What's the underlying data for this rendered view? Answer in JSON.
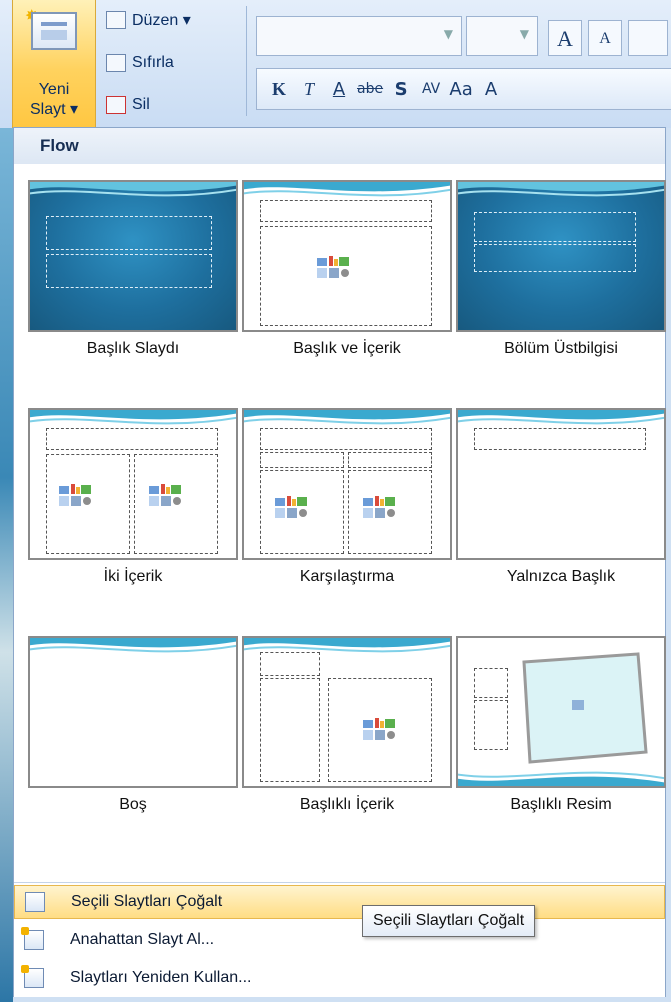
{
  "ribbon": {
    "new_slide_line1": "Yeni",
    "new_slide_line2": "Slayt ▾",
    "layout_label": "Düzen ▾",
    "reset_label": "Sıfırla",
    "delete_label": "Sil",
    "format_buttons": [
      "K",
      "T",
      "A",
      "abe",
      "S",
      "AV",
      "Aa",
      "A"
    ],
    "grow_font": "A",
    "shrink_font": "A"
  },
  "panel": {
    "theme_header": "Flow",
    "layouts": [
      {
        "caption": "Başlık Slaydı"
      },
      {
        "caption": "Başlık ve İçerik"
      },
      {
        "caption": "Bölüm Üstbilgisi"
      },
      {
        "caption": "İki İçerik"
      },
      {
        "caption": "Karşılaştırma"
      },
      {
        "caption": "Yalnızca Başlık"
      },
      {
        "caption": "Boş"
      },
      {
        "caption": "Başlıklı İçerik"
      },
      {
        "caption": "Başlıklı Resim"
      }
    ],
    "menu": [
      {
        "label": "Seçili Slaytları Çoğalt",
        "icon": "duplicate-slides-icon"
      },
      {
        "label": "Anahattan Slayt Al...",
        "icon": "slides-from-outline-icon"
      },
      {
        "label": "Slaytları Yeniden Kullan...",
        "icon": "reuse-slides-icon"
      }
    ]
  },
  "tooltip": {
    "text": "Seçili Slaytları Çoğalt"
  },
  "colors": {
    "accent_selected": "#ffd25e",
    "theme_blue": "#1e6f9e"
  }
}
